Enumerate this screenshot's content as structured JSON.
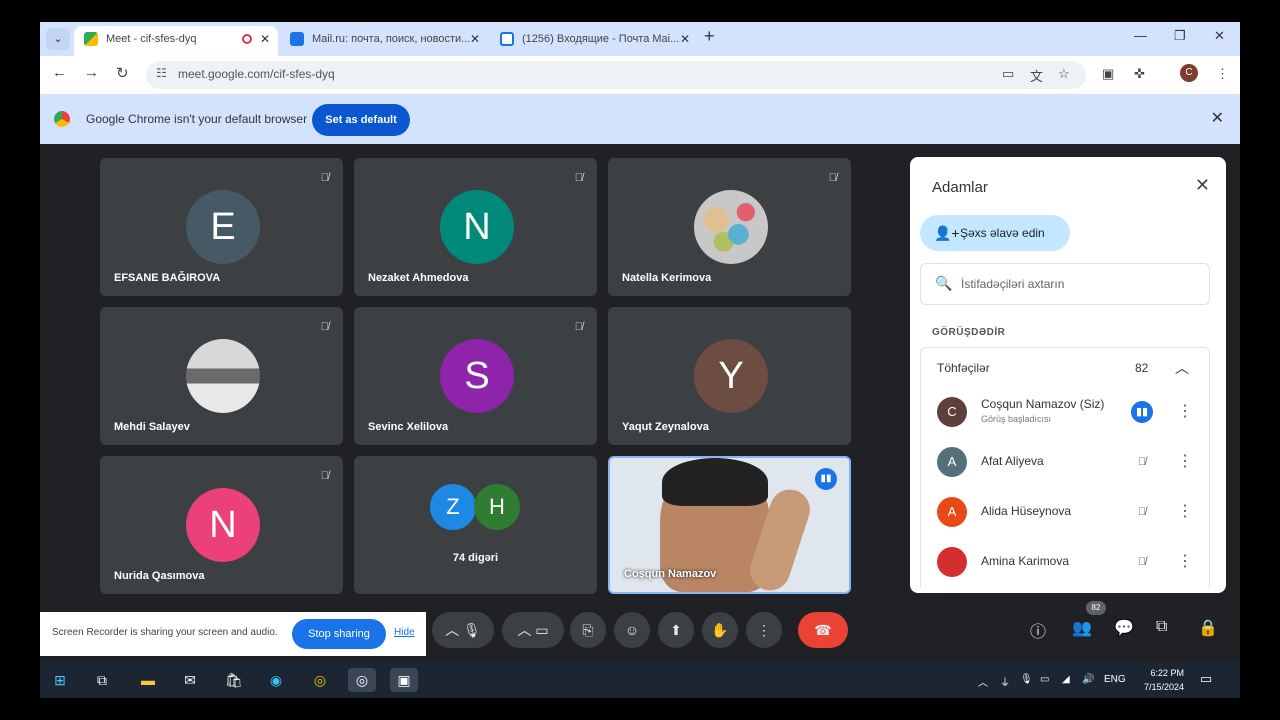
{
  "browser": {
    "tabs": [
      {
        "title": "Meet - cif-sfes-dyq",
        "active": true
      },
      {
        "title": "Mail.ru: почта, поиск, новости..."
      },
      {
        "title": "(1256) Входящие - Почта Mai..."
      }
    ],
    "url": "meet.google.com/cif-sfes-dyq",
    "infobar_message": "Google Chrome isn't your default browser",
    "infobar_button": "Set as default",
    "profile_initial": "C"
  },
  "tiles": [
    {
      "initial": "E",
      "name": "EFSANE BAĞIROVA",
      "color": "#455a64"
    },
    {
      "initial": "N",
      "name": "Nezaket Ahmedova",
      "color": "#00897b"
    },
    {
      "initial": "",
      "name": "Natella Kerimova"
    },
    {
      "initial": "",
      "name": "Mehdi Salayev"
    },
    {
      "initial": "S",
      "name": "Sevinc Xelilova",
      "color": "#8e24aa"
    },
    {
      "initial": "Y",
      "name": "Yaqut Zeynalova",
      "color": "#6d4c41"
    },
    {
      "initial": "N",
      "name": "Nurida Qasımova",
      "color": "#ec407a"
    },
    {
      "initial_a": "Z",
      "initial_b": "H",
      "name": "74 digəri"
    },
    {
      "name": "Coşqun Namazov"
    }
  ],
  "panel": {
    "title": "Adamlar",
    "add_button": "Şəxs əlavə edin",
    "search_placeholder": "İstifadəçiləri axtarın",
    "section": "GÖRÜŞDƏDİR",
    "group_label": "Töhfəçilər",
    "group_count": "82",
    "people": [
      {
        "initial": "C",
        "name": "Coşqun Namazov (Siz)",
        "sub": "Görüş başladıcısı",
        "color": "#5d4037"
      },
      {
        "initial": "A",
        "name": "Afat Aliyeva",
        "color": "#546e7a"
      },
      {
        "initial": "A",
        "name": "Alida Hüseynova",
        "color": "#e64a19"
      },
      {
        "initial": "",
        "name": "Amina Karimova",
        "color": "#d32f2f"
      }
    ]
  },
  "sharebar": {
    "message": "Screen Recorder is sharing your screen and audio.",
    "stop": "Stop sharing",
    "hide": "Hide"
  },
  "controls": {
    "people_badge": "82"
  },
  "taskbar": {
    "lang": "ENG",
    "time": "6:22 PM",
    "date": "7/15/2024"
  }
}
